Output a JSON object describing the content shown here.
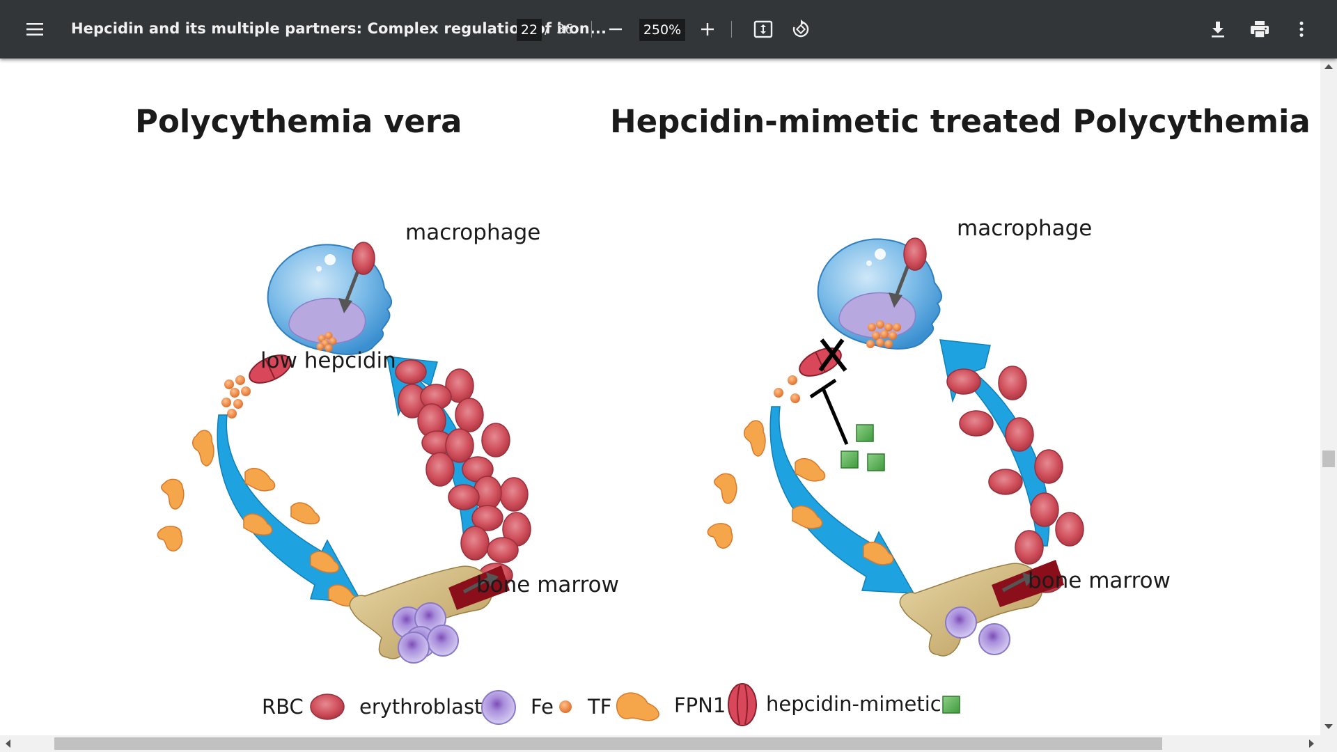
{
  "toolbar": {
    "menu_icon": "hamburger-menu-icon",
    "title": "Hepcidin and its multiple partners: Complex regulation of iron...",
    "page_current": "22",
    "page_separator": "/",
    "page_total": "36",
    "zoom_out_icon": "minus-icon",
    "zoom_level": "250%",
    "zoom_in_icon": "plus-icon",
    "fit_page_icon": "fit-to-page-icon",
    "rotate_icon": "rotate-icon",
    "download_icon": "download-icon",
    "print_icon": "print-icon",
    "more_icon": "more-vertical-icon",
    "bg_color": "#323639"
  },
  "figure": {
    "left_panel": {
      "title": "Polycythemia vera",
      "macrophage_label": "macrophage",
      "hepcidin_label": "low hepcidin",
      "marrow_label": "bone marrow"
    },
    "right_panel": {
      "title": "Hepcidin-mimetic treated Polycythemia vera",
      "macrophage_label": "macrophage",
      "marrow_label": "bone marrow"
    },
    "legend": [
      {
        "label": "RBC",
        "icon": "rbc-icon"
      },
      {
        "label": "erythroblast",
        "icon": "erythroblast-icon"
      },
      {
        "label": "Fe",
        "icon": "fe-icon"
      },
      {
        "label": "TF",
        "icon": "transferrin-icon"
      },
      {
        "label": "FPN1",
        "icon": "ferroportin-icon"
      },
      {
        "label": "hepcidin-mimetic",
        "icon": "hepcidin-mimetic-icon"
      }
    ],
    "colors": {
      "rbc": "#d0525e",
      "macrophage": "#5ba8e0",
      "arrow": "#1fa3e0",
      "fe": "#f08a3c",
      "tf": "#f5a54a",
      "erythroblast": "#9b8ad6",
      "bone": "#d6c08a",
      "mimetic": "#5fb05a"
    }
  }
}
